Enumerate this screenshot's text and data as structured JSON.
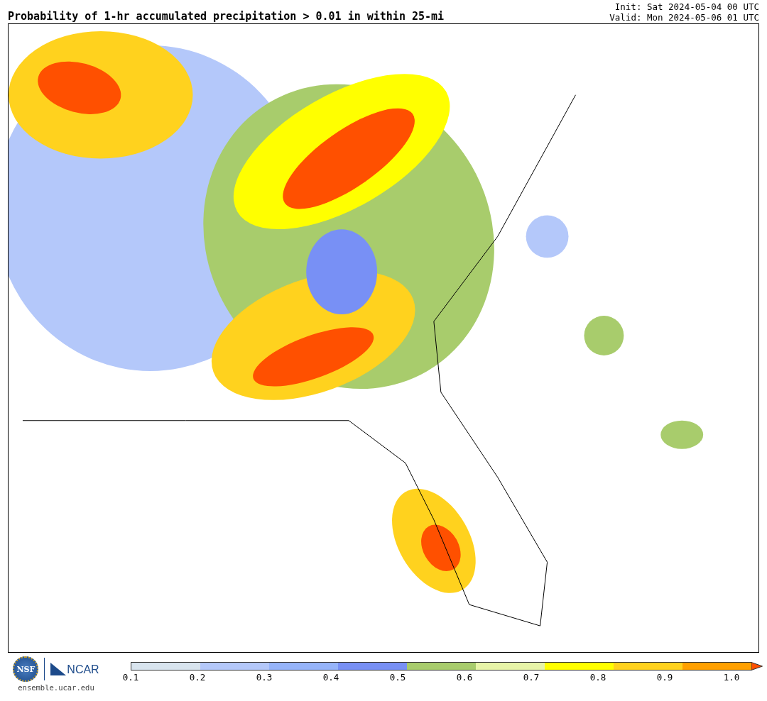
{
  "title": "Probability of 1-hr accumulated precipitation > 0.01 in within 25-mi",
  "init": "Init: Sat 2024-05-04 00 UTC",
  "valid": "Valid: Mon 2024-05-06 01 UTC",
  "logos": {
    "nsf": "NSF",
    "ncar": "NCAR",
    "site": "ensemble.ucar.edu"
  },
  "colorbar": {
    "segments": [
      {
        "color": "#d8e4ee"
      },
      {
        "color": "#b4c8fa"
      },
      {
        "color": "#96b4fa"
      },
      {
        "color": "#7890f5"
      },
      {
        "color": "#a8cc6c"
      },
      {
        "color": "#e8f5a8"
      },
      {
        "color": "#ffff00"
      },
      {
        "color": "#ffd21e"
      },
      {
        "color": "#ffa000"
      },
      {
        "kind": "arrow",
        "color": "#ff5000"
      }
    ],
    "ticks": [
      "0.1",
      "0.2",
      "0.3",
      "0.4",
      "0.5",
      "0.6",
      "0.7",
      "0.8",
      "0.9",
      "1.0"
    ]
  }
}
